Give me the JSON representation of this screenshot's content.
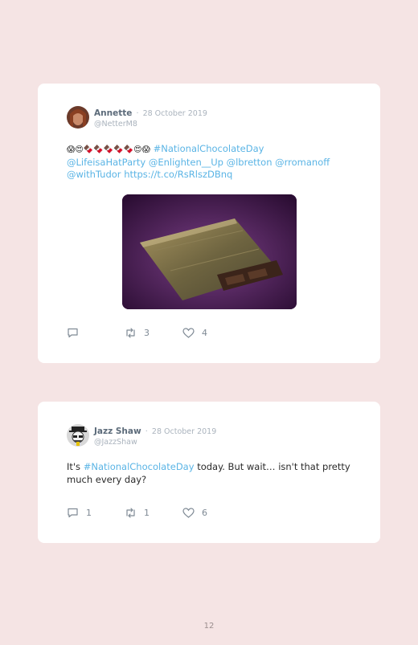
{
  "tweets": [
    {
      "author": "Annette",
      "separator": "·",
      "date": "28 October 2019",
      "handle": "@NetterM8",
      "text_prefix": "",
      "emoji_prefix": "😱😍🍫🍫🍫🍫🍫😍😱",
      "hashtag": "#NationalChocolateDay",
      "mentions_line": "@LifeisaHatParty @Enlighten__Up @lbretton @rromanoff",
      "last_line_mention": "@withTudor",
      "url": "https://t.co/RsRlszDBnq",
      "has_media": true,
      "replies": "",
      "retweets": "3",
      "likes": "4"
    },
    {
      "author": "Jazz Shaw",
      "separator": "·",
      "date": "28 October 2019",
      "handle": "@JazzShaw",
      "text_prefix": "It's",
      "hashtag": "#NationalChocolateDay",
      "text_suffix": "today. But wait… isn't that pretty much every day?",
      "has_media": false,
      "replies": "1",
      "retweets": "1",
      "likes": "6"
    }
  ],
  "page_number": "12",
  "colors": {
    "background": "#f5e4e4",
    "card": "#ffffff",
    "link": "#5ab4e5",
    "name": "#5c6b7a",
    "muted": "#aab3bd"
  }
}
